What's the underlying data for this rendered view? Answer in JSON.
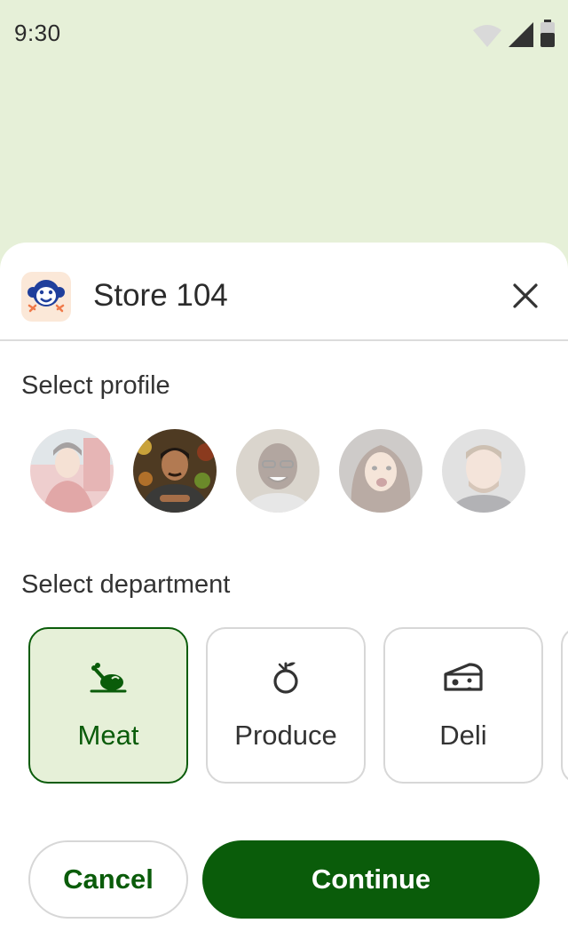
{
  "status_bar": {
    "time": "9:30",
    "icons": [
      "wifi-icon",
      "cellular-signal-icon",
      "battery-icon"
    ]
  },
  "header": {
    "app_icon": "monkey-logo-icon",
    "title": "Store 104",
    "close_icon": "close-icon"
  },
  "profile_section": {
    "title": "Select profile",
    "profiles": [
      {
        "selected": false
      },
      {
        "selected": true
      },
      {
        "selected": false
      },
      {
        "selected": false
      },
      {
        "selected": false
      }
    ]
  },
  "department_section": {
    "title": "Select department",
    "departments": [
      {
        "label": "Meat",
        "icon": "roast-chicken-icon",
        "selected": true
      },
      {
        "label": "Produce",
        "icon": "apple-icon",
        "selected": false
      },
      {
        "label": "Deli",
        "icon": "cheese-icon",
        "selected": false
      }
    ]
  },
  "actions": {
    "cancel_label": "Cancel",
    "continue_label": "Continue"
  },
  "colors": {
    "accent": "#0a5c0a",
    "selected_bg": "#e6f0d8",
    "backdrop": "#e6f0d8"
  }
}
